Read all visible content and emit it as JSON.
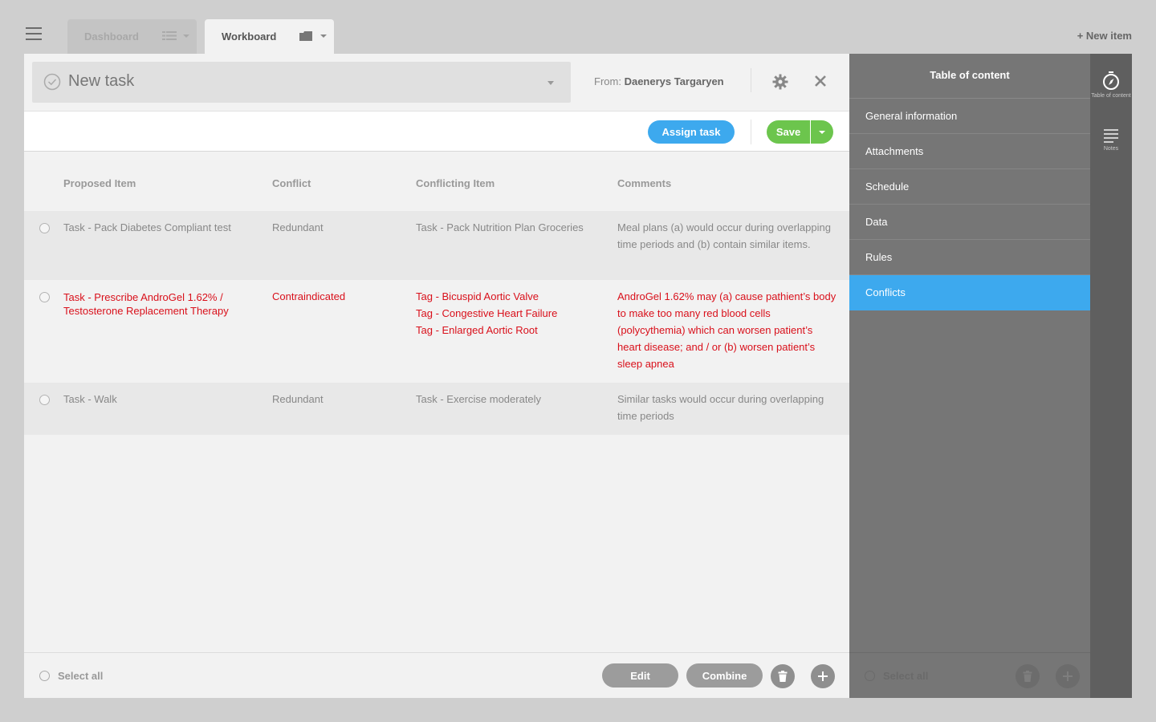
{
  "nav": {
    "tabs": [
      {
        "label": "Dashboard",
        "icon": "list-icon",
        "active": false
      },
      {
        "label": "Workboard",
        "icon": "folder-icon",
        "active": true
      }
    ],
    "new_item": "+ New item"
  },
  "task": {
    "title": "New task",
    "from_label": "From:",
    "from_name": "Daenerys Targaryen"
  },
  "toolbar": {
    "assign_label": "Assign task",
    "save_label": "Save"
  },
  "table": {
    "headers": [
      "Proposed Item",
      "Conflict",
      "Conflicting Item",
      "Comments"
    ],
    "rows": [
      {
        "proposed": "Task - Pack Diabetes Compliant test",
        "conflict": "Redundant",
        "conflicting": [
          "Task - Pack Nutrition Plan Groceries"
        ],
        "comments": "Meal plans (a) would occur during overlapping time periods and (b) contain similar items.",
        "alert": false
      },
      {
        "proposed": "Task - Prescribe AndroGel 1.62% / Testosterone Replacement Therapy",
        "conflict": "Contraindicated",
        "conflicting": [
          "Tag - Bicuspid Aortic Valve",
          "Tag - Congestive Heart Failure",
          "Tag - Enlarged Aortic Root"
        ],
        "comments": "AndroGel 1.62% may (a) cause pathient’s body to make too many red blood cells (polycythemia) which can worsen patient’s heart disease; and / or (b) worsen patient’s sleep apnea",
        "alert": true
      },
      {
        "proposed": "Task - Walk",
        "conflict": "Redundant",
        "conflicting": [
          "Task - Exercise moderately"
        ],
        "comments": "Similar tasks would occur during overlapping time periods",
        "alert": false
      }
    ]
  },
  "footer": {
    "select_all": "Select all",
    "edit_label": "Edit",
    "combine_label": "Combine"
  },
  "toc": {
    "title": "Table of content",
    "items": [
      "General information",
      "Attachments",
      "Schedule",
      "Data",
      "Rules",
      "Conflicts"
    ],
    "active_index": 5,
    "footer_select_all": "Select all"
  },
  "rail": {
    "items": [
      {
        "label": "Table of content",
        "icon": "compass-icon"
      },
      {
        "label": "Notes",
        "icon": "notes-icon"
      }
    ]
  },
  "colors": {
    "accent_blue": "#3da9ee",
    "save_green": "#6cc54d",
    "alert_red": "#d9101b",
    "toc_bg": "#767676",
    "rail_bg": "#5f5f5f"
  }
}
